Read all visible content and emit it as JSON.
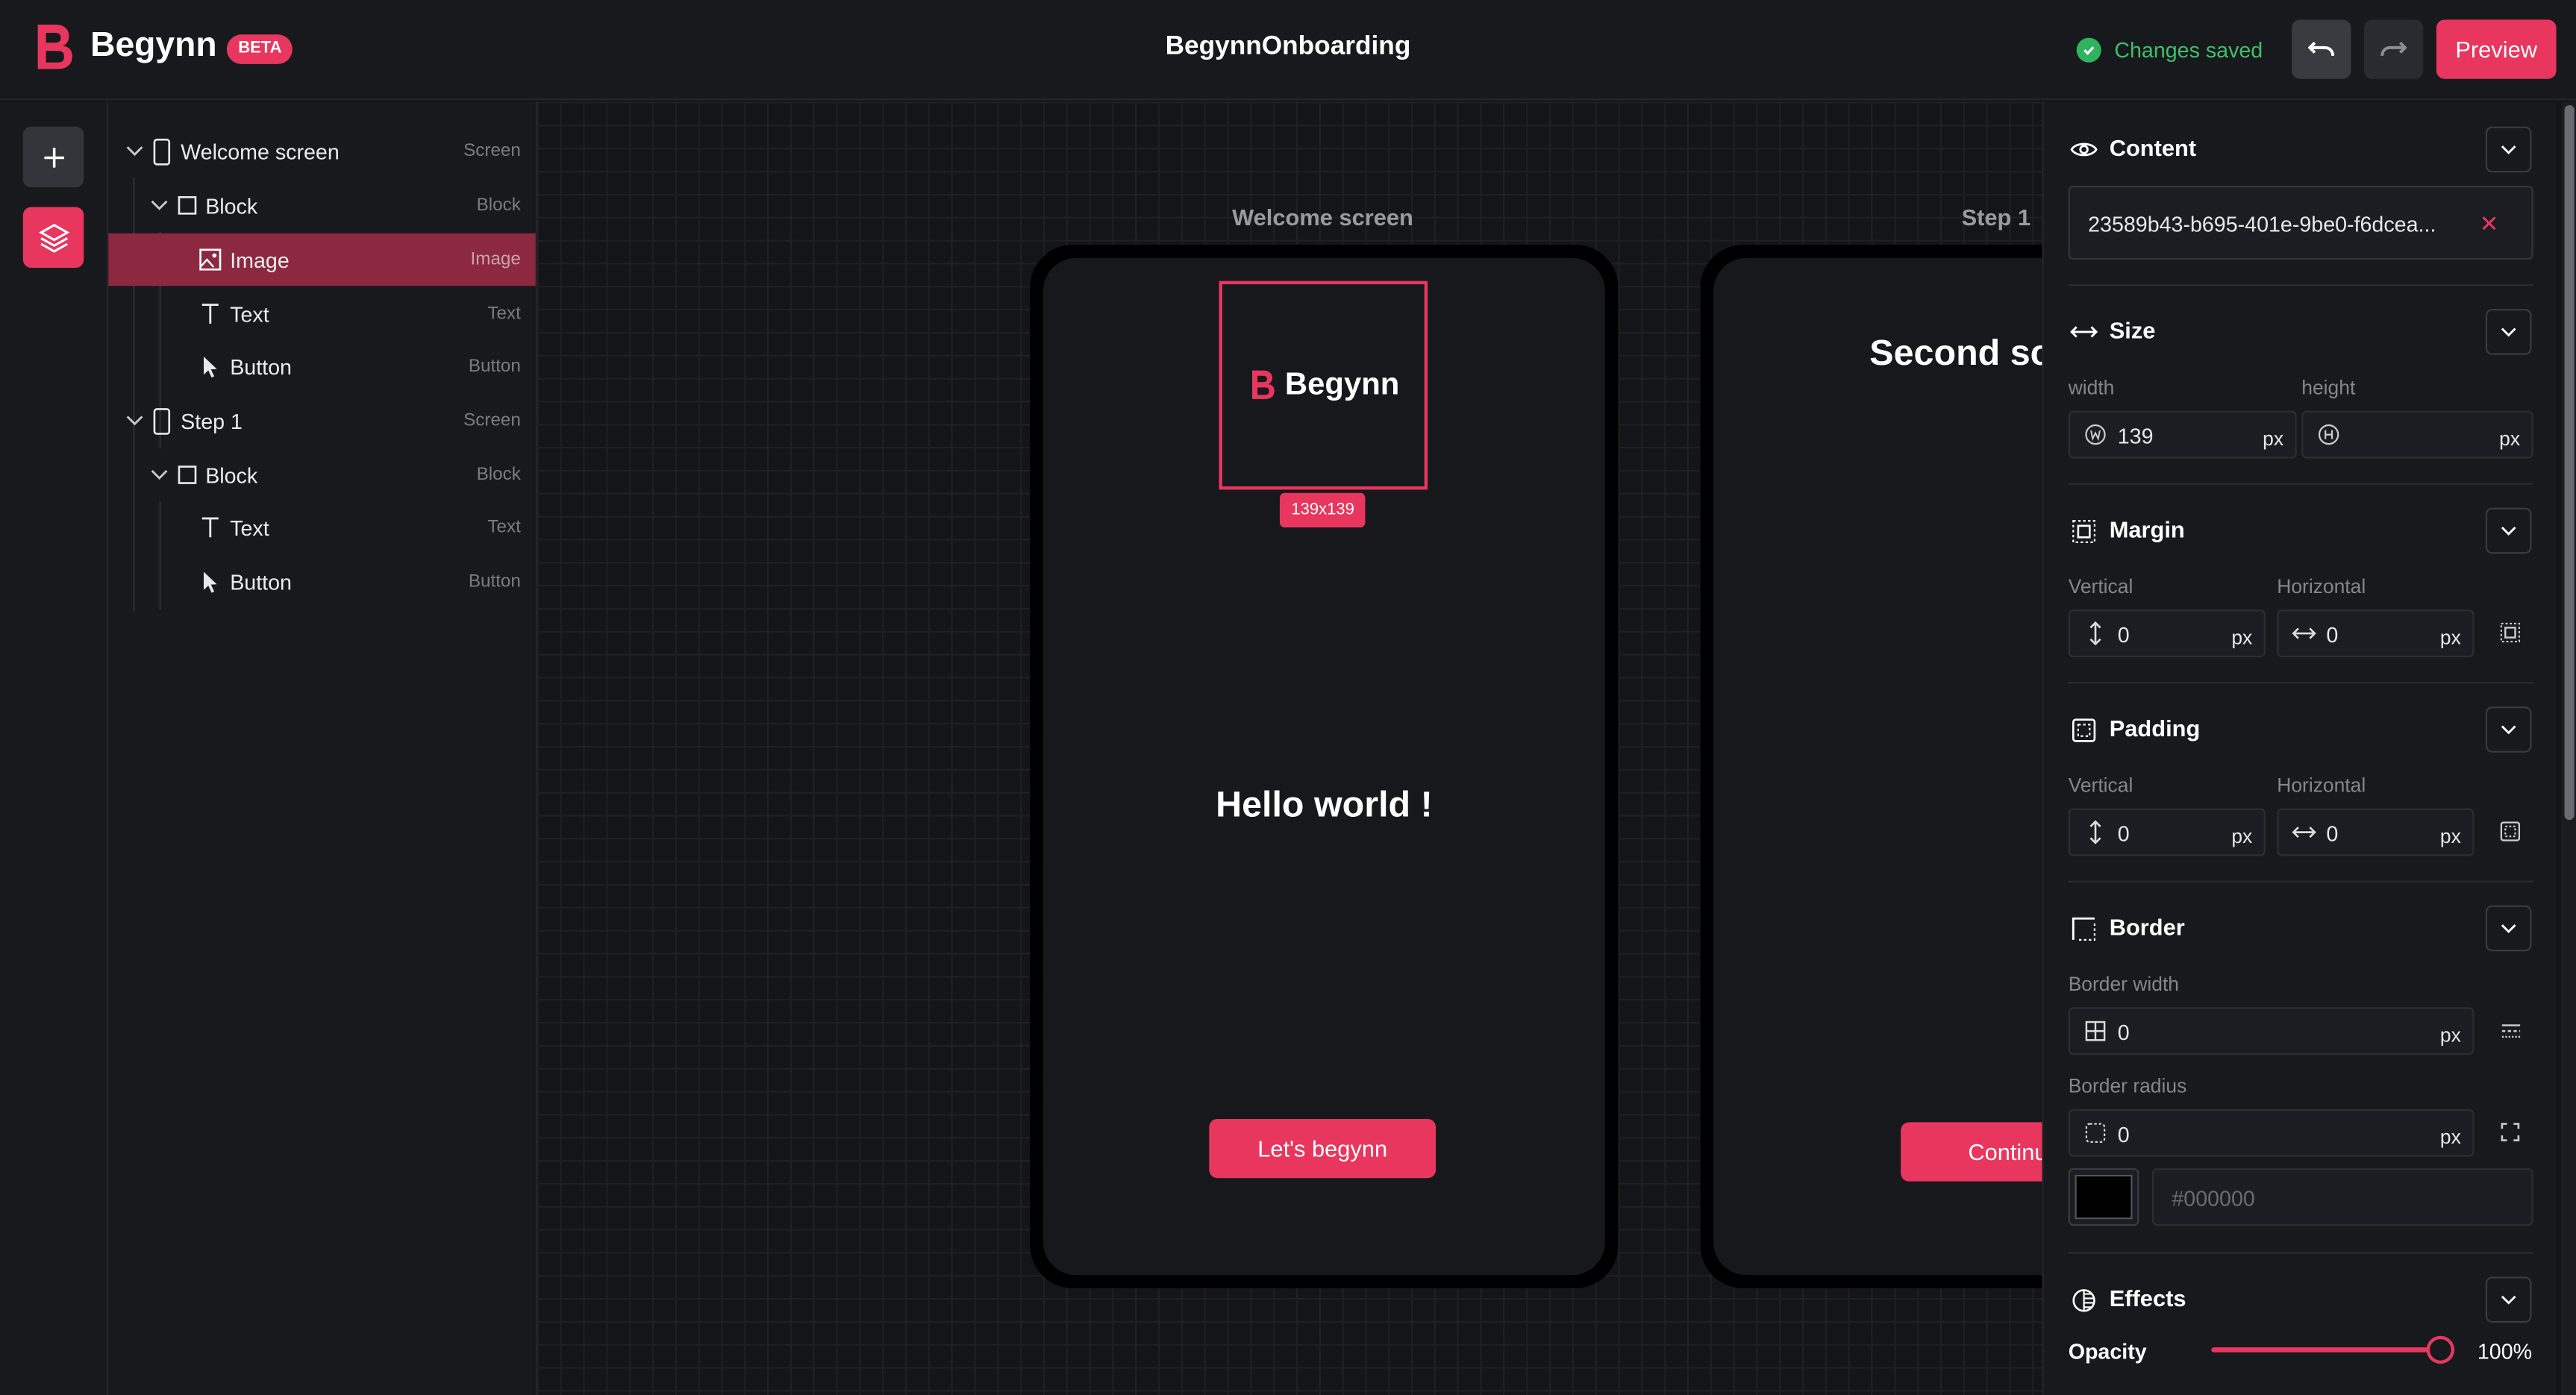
{
  "colors": {
    "accent": "#e8365f",
    "saved_green": "#2fb35f",
    "background": "#141519"
  },
  "header": {
    "brand": "Begynn",
    "badge": "BETA",
    "title": "BegynnOnboarding",
    "status": "Changes saved",
    "undo_icon": "undo-icon",
    "redo_icon": "redo-icon",
    "preview_label": "Preview"
  },
  "rail": {
    "add_icon": "plus-icon",
    "layers_icon": "layers-icon"
  },
  "layers": [
    {
      "label": "Welcome screen",
      "type": "Screen",
      "icon": "phone-icon"
    },
    {
      "label": "Block",
      "type": "Block",
      "icon": "square-icon"
    },
    {
      "label": "Image",
      "type": "Image",
      "icon": "image-icon",
      "selected": true
    },
    {
      "label": "Text",
      "type": "Text",
      "icon": "text-icon"
    },
    {
      "label": "Button",
      "type": "Button",
      "icon": "cursor-icon"
    },
    {
      "label": "Step 1",
      "type": "Screen",
      "icon": "phone-icon"
    },
    {
      "label": "Block",
      "type": "Block",
      "icon": "square-icon"
    },
    {
      "label": "Text",
      "type": "Text",
      "icon": "text-icon"
    },
    {
      "label": "Button",
      "type": "Button",
      "icon": "cursor-icon"
    }
  ],
  "canvas": {
    "screen1": {
      "label": "Welcome screen",
      "logo_text": "Begynn",
      "size_tag": "139x139",
      "heading": "Hello world !",
      "button": "Let's begynn"
    },
    "screen2": {
      "label": "Step 1",
      "heading": "Second sc",
      "button": "Continue"
    }
  },
  "props": {
    "content": {
      "title": "Content",
      "value": "23589b43-b695-401e-9be0-f6dcea...",
      "clear": "✕"
    },
    "size": {
      "title": "Size",
      "width_label": "width",
      "height_label": "height",
      "width": "139",
      "height": "",
      "unit": "px"
    },
    "margin": {
      "title": "Margin",
      "vertical_label": "Vertical",
      "horizontal_label": "Horizontal",
      "vertical": "0",
      "horizontal": "0",
      "unit": "px"
    },
    "padding": {
      "title": "Padding",
      "vertical_label": "Vertical",
      "horizontal_label": "Horizontal",
      "vertical": "0",
      "horizontal": "0",
      "unit": "px"
    },
    "border": {
      "title": "Border",
      "width_label": "Border width",
      "width": "0",
      "radius_label": "Border radius",
      "radius": "0",
      "unit": "px",
      "color_placeholder": "#000000",
      "color": "#000000"
    },
    "effects": {
      "title": "Effects",
      "opacity_label": "Opacity",
      "opacity_value": "100%",
      "opacity": 1.0
    }
  }
}
